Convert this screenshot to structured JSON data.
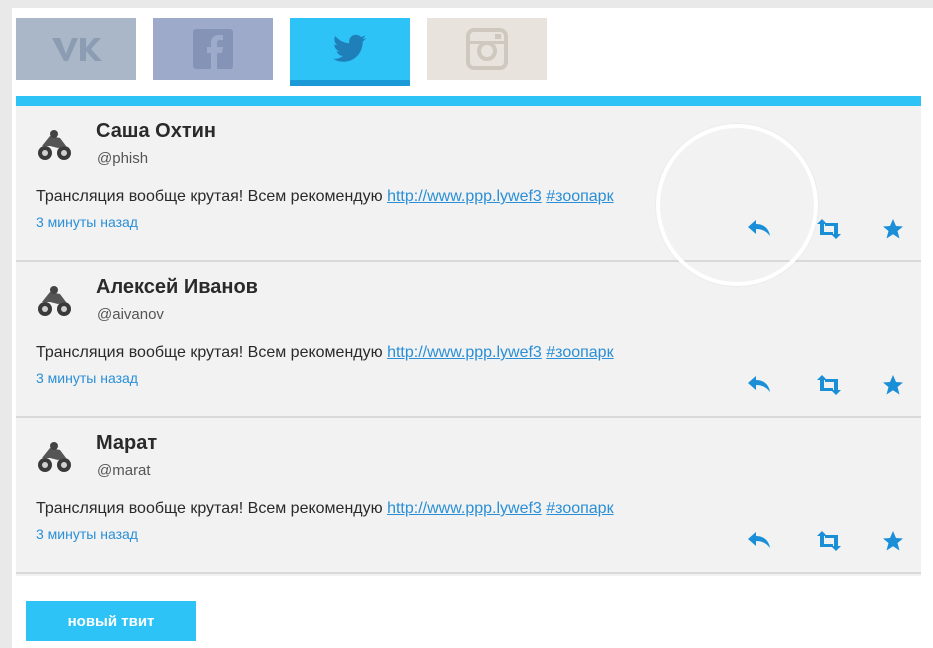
{
  "tabs": [
    {
      "id": "vk",
      "icon": "vk-icon",
      "color": "#a9b7c8"
    },
    {
      "id": "facebook",
      "icon": "facebook-icon",
      "color": "#9eaac9"
    },
    {
      "id": "twitter",
      "icon": "twitter-icon",
      "color": "#2ec3f7",
      "active": true
    },
    {
      "id": "instagram",
      "icon": "instagram-icon",
      "color": "#e8e3dc"
    }
  ],
  "accent_color": "#2ec3f7",
  "link_color": "#2a8fd6",
  "tweets": [
    {
      "name": "Саша Охтин",
      "handle": "@phish",
      "text": "Трансляция вообще крутая! Всем рекомендую ",
      "link": "http://www.ppp.lywef3",
      "hashtag": "#зоопарк",
      "time": "3 минуты назад"
    },
    {
      "name": "Алексей Иванов",
      "handle": "@aivanov",
      "text": "Трансляция вообще крутая! Всем рекомендую ",
      "link": "http://www.ppp.lywef3",
      "hashtag": "#зоопарк",
      "time": "3 минуты назад"
    },
    {
      "name": "Марат",
      "handle": "@marat",
      "text": "Трансляция вообще крутая! Всем рекомендую ",
      "link": "http://www.ppp.lywef3",
      "hashtag": "#зоопарк",
      "time": "3 минуты назад"
    }
  ],
  "new_tweet_label": "новый твит"
}
